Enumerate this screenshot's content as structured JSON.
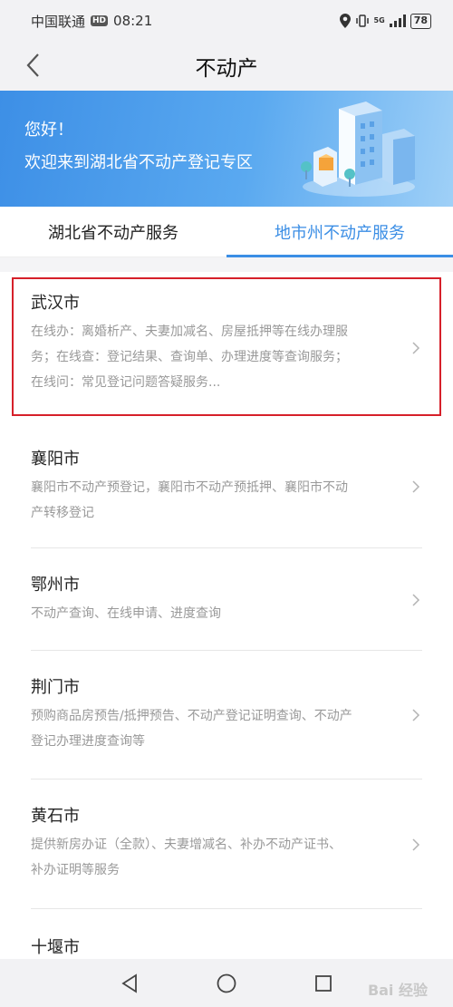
{
  "status_bar": {
    "carrier": "中国联通",
    "hd": "HD",
    "time": "08:21",
    "network": "5G",
    "battery": "78"
  },
  "header": {
    "title": "不动产",
    "back_icon": "chevron-left-icon"
  },
  "banner": {
    "greeting": "您好！",
    "welcome": "欢迎来到湖北省不动产登记专区"
  },
  "tabs": [
    {
      "label": "湖北省不动产服务",
      "active": false
    },
    {
      "label": "地市州不动产服务",
      "active": true
    }
  ],
  "cities": [
    {
      "name": "武汉市",
      "lines": [
        "在线办：离婚析产、夫妻加减名、房屋抵押等在线办理服",
        "务；在线查：登记结果、查询单、办理进度等查询服务；",
        "在线问：常见登记问题答疑服务..."
      ]
    },
    {
      "name": "襄阳市",
      "lines": [
        "襄阳市不动产预登记，襄阳市不动产预抵押、襄阳市不动",
        "产转移登记"
      ]
    },
    {
      "name": "鄂州市",
      "lines": [
        "不动产查询、在线申请、进度查询"
      ]
    },
    {
      "name": "荆门市",
      "lines": [
        "预购商品房预告/抵押预告、不动产登记证明查询、不动产",
        "登记办理进度查询等"
      ]
    },
    {
      "name": "黄石市",
      "lines": [
        "提供新房办证（全款）、夫妻增减名、补办不动产证书、",
        "补办证明等服务"
      ]
    },
    {
      "name": "十堰市",
      "lines": []
    }
  ],
  "colors": {
    "accent": "#3b8ee5",
    "highlight": "#d6202a"
  },
  "watermark": "Bai 经验"
}
